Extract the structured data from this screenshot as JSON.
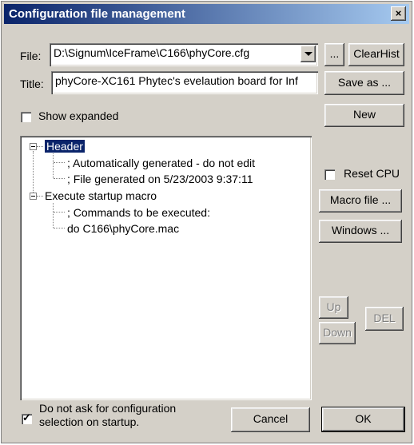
{
  "window": {
    "title": "Configuration file management",
    "close_label": "×"
  },
  "file": {
    "label": "File:",
    "value": "D:\\Signum\\IceFrame\\C166\\phyCore.cfg"
  },
  "title_field": {
    "label": "Title:",
    "value": "phyCore-XC161 Phytec's evelaution board for Inf"
  },
  "buttons": {
    "browse": "...",
    "clear_hist": "ClearHist",
    "save_as": "Save as ...",
    "new": "New",
    "macro_file": "Macro file ...",
    "windows": "Windows ...",
    "up": "Up",
    "down": "Down",
    "del": "DEL",
    "cancel": "Cancel",
    "ok": "OK"
  },
  "show_expanded": {
    "label": "Show expanded",
    "checked": false
  },
  "reset_cpu": {
    "label": "Reset CPU",
    "checked": false
  },
  "do_not_ask": {
    "line1": "Do not ask for configuration",
    "line2": "selection on startup.",
    "checked": true
  },
  "tree": {
    "header": {
      "label": "Header",
      "children": [
        "; Automatically generated - do not edit",
        "; File generated on 5/23/2003 9:37:11"
      ]
    },
    "startup": {
      "label": "Execute startup macro",
      "children": [
        "; Commands to be executed:",
        "do C166\\phyCore.mac"
      ]
    }
  }
}
